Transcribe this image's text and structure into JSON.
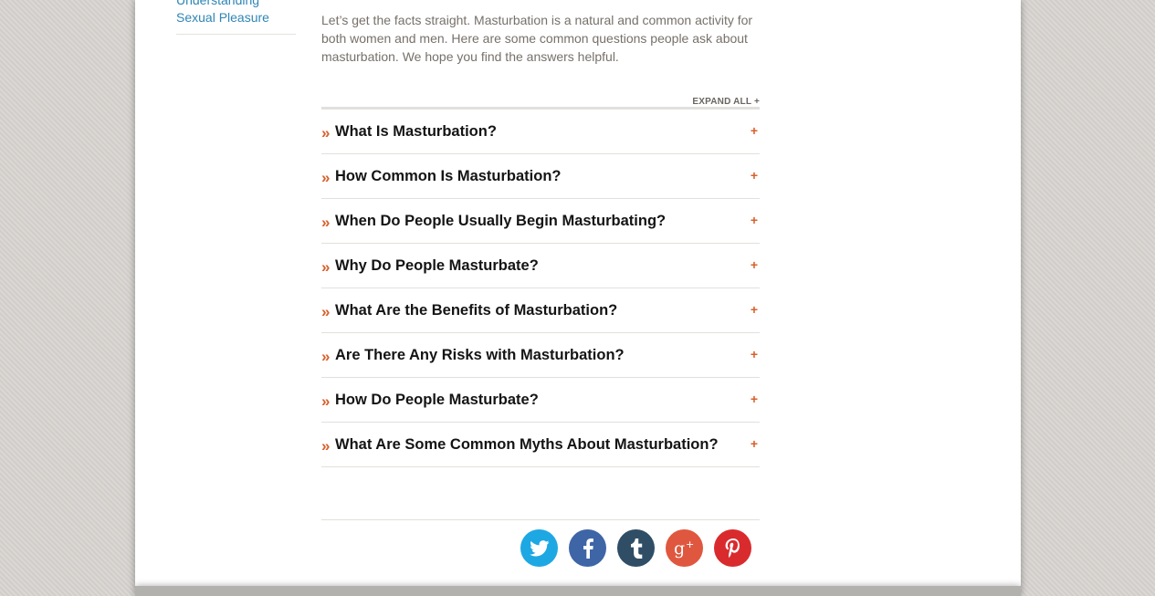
{
  "sidebar": {
    "link_line1": "Understanding",
    "link_line2": "Sexual Pleasure"
  },
  "intro": "Let’s get the facts straight. Masturbation is a natural and common activity for both women and men. Here are some common questions people ask about masturbation. We hope you find the answers helpful.",
  "expand_all": "EXPAND ALL +",
  "faq": {
    "bullet": "»",
    "plus": "+",
    "items": [
      "What Is Masturbation?",
      "How Common Is Masturbation?",
      "When Do People Usually Begin Masturbating?",
      "Why Do People Masturbate?",
      "What Are the Benefits of Masturbation?",
      "Are There Any Risks with Masturbation?",
      "How Do People Masturbate?",
      "What Are Some Common Myths About Masturbation?"
    ]
  },
  "share": [
    {
      "name": "twitter-icon",
      "color": "#1da8e3"
    },
    {
      "name": "facebook-icon",
      "color": "#3e65a6"
    },
    {
      "name": "tumblr-icon",
      "color": "#2f4e66"
    },
    {
      "name": "google-plus-icon",
      "color": "#e0573f"
    },
    {
      "name": "pinterest-icon",
      "color": "#d92b2e"
    }
  ],
  "colors": {
    "accent": "#d8602b",
    "link": "#2f86b5",
    "body_text": "#77706a"
  }
}
